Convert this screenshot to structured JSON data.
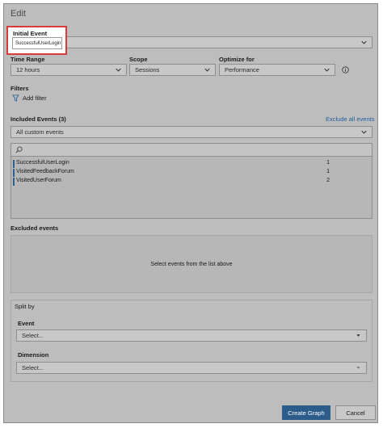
{
  "dialog": {
    "title": "Edit"
  },
  "initial_event": {
    "label": "Initial Event",
    "value": "SuccessfulUserLogin"
  },
  "time_range": {
    "label": "Time Range",
    "value": "12 hours"
  },
  "scope": {
    "label": "Scope",
    "value": "Sessions"
  },
  "optimize_for": {
    "label": "Optimize for",
    "value": "Performance"
  },
  "filters": {
    "label": "Filters",
    "add_label": "Add filter"
  },
  "included_events": {
    "label": "Included Events (3)",
    "exclude_all_label": "Exclude all events",
    "dropdown_value": "All custom events",
    "items": [
      {
        "name": "SuccessfulUserLogin",
        "count": "1"
      },
      {
        "name": "VisitedFeedbackForum",
        "count": "1"
      },
      {
        "name": "VisitedUserForum",
        "count": "2"
      }
    ]
  },
  "excluded_events": {
    "label": "Excluded events",
    "empty_text": "Select events from the list above"
  },
  "split_by": {
    "label": "Split by",
    "event_label": "Event",
    "event_placeholder": "Select...",
    "dimension_label": "Dimension",
    "dimension_placeholder": "Select..."
  },
  "footer": {
    "create_label": "Create Graph",
    "cancel_label": "Cancel"
  },
  "colors": {
    "primary": "#2e5c8a",
    "link": "#1f5f9c",
    "highlight": "#d93a3a"
  }
}
